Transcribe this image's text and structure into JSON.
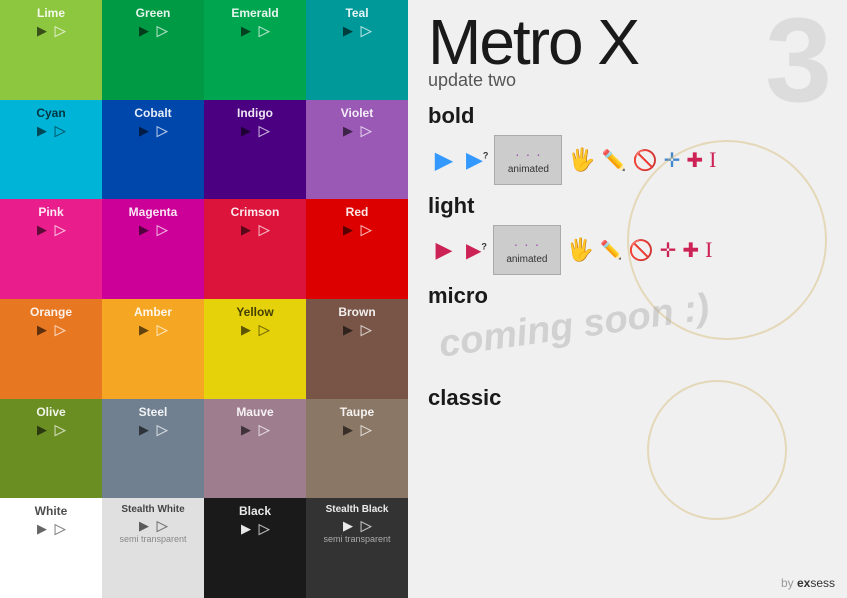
{
  "left": {
    "tiles": [
      {
        "id": "lime",
        "label": "Lime",
        "class": "t-lime",
        "dark": false
      },
      {
        "id": "green",
        "label": "Green",
        "class": "t-green",
        "dark": false
      },
      {
        "id": "emerald",
        "label": "Emerald",
        "class": "t-emerald",
        "dark": false
      },
      {
        "id": "teal",
        "label": "Teal",
        "class": "t-teal",
        "dark": false
      },
      {
        "id": "cyan",
        "label": "Cyan",
        "class": "t-cyan",
        "dark": false
      },
      {
        "id": "cobalt",
        "label": "Cobalt",
        "class": "t-cobalt",
        "dark": false
      },
      {
        "id": "indigo",
        "label": "Indigo",
        "class": "t-indigo",
        "dark": false
      },
      {
        "id": "violet",
        "label": "Violet",
        "class": "t-violet",
        "dark": false
      },
      {
        "id": "pink",
        "label": "Pink",
        "class": "t-pink",
        "dark": false
      },
      {
        "id": "magenta",
        "label": "Magenta",
        "class": "t-magenta",
        "dark": false
      },
      {
        "id": "crimson",
        "label": "Crimson",
        "class": "t-crimson",
        "dark": false
      },
      {
        "id": "red",
        "label": "Red",
        "class": "t-red",
        "dark": false
      },
      {
        "id": "orange",
        "label": "Orange",
        "class": "t-orange",
        "dark": false
      },
      {
        "id": "amber",
        "label": "Amber",
        "class": "t-amber",
        "dark": false
      },
      {
        "id": "yellow",
        "label": "Yellow",
        "class": "t-yellow",
        "dark": true
      },
      {
        "id": "brown",
        "label": "Brown",
        "class": "t-brown",
        "dark": false
      },
      {
        "id": "olive",
        "label": "Olive",
        "class": "t-olive",
        "dark": false
      },
      {
        "id": "steel",
        "label": "Steel",
        "class": "t-steel",
        "dark": false
      },
      {
        "id": "mauve",
        "label": "Mauve",
        "class": "t-mauve",
        "dark": false
      },
      {
        "id": "taupe",
        "label": "Taupe",
        "class": "t-taupe",
        "dark": false
      },
      {
        "id": "white",
        "label": "White",
        "class": "t-white",
        "dark": true
      },
      {
        "id": "stealth-white",
        "label": "Stealth White",
        "class": "t-stealth-white",
        "dark": true
      },
      {
        "id": "black",
        "label": "Black",
        "class": "t-black",
        "dark": false
      },
      {
        "id": "stealth-black",
        "label": "Stealth Black",
        "class": "t-stealth-black",
        "dark": false
      }
    ]
  },
  "right": {
    "title": "Metro X",
    "number": "3",
    "subtitle": "update two",
    "sections": [
      {
        "id": "bold",
        "label": "bold"
      },
      {
        "id": "light",
        "label": "light"
      },
      {
        "id": "micro",
        "label": "micro"
      },
      {
        "id": "classic",
        "label": "classic"
      }
    ],
    "animated_label": "animated",
    "coming_soon": "coming soon :)",
    "by_label": "by ",
    "ex_label": "ex",
    "sess_label": "sess"
  }
}
